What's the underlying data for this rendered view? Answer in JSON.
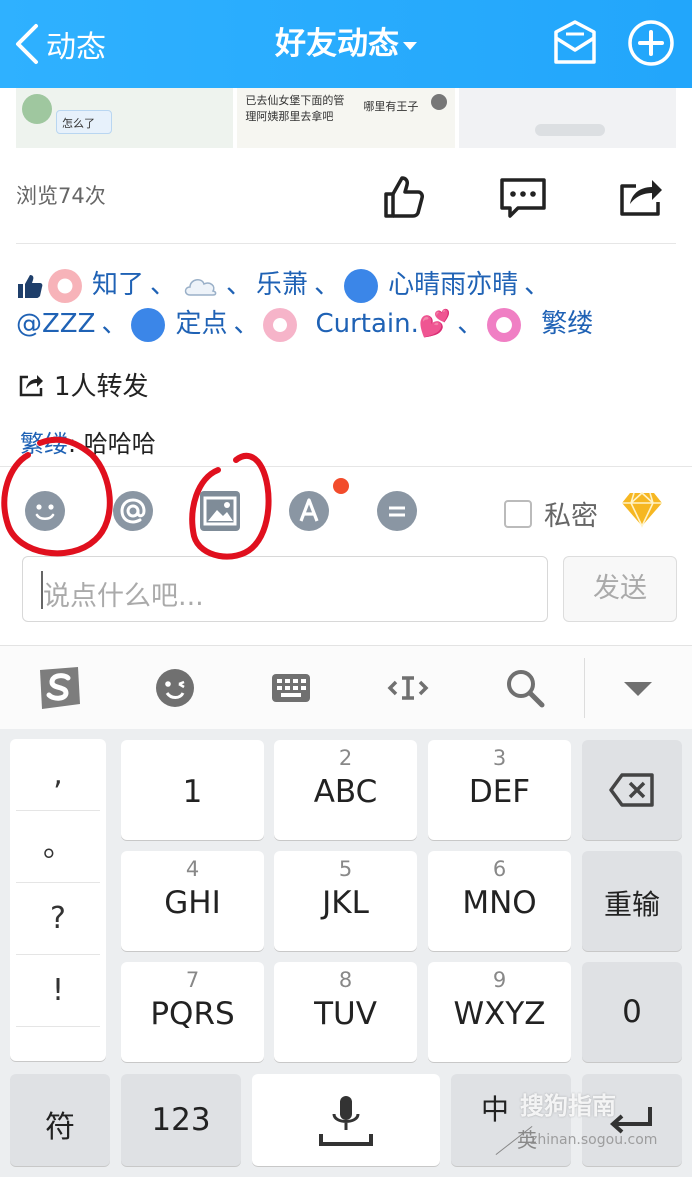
{
  "header": {
    "back_label": "动态",
    "title": "好友动态"
  },
  "thumbs": [
    {
      "texts": [
        "怎么了"
      ]
    },
    {
      "texts": [
        "已去仙女堡下面的管",
        "理阿姨那里去拿吧",
        "哪里有王子"
      ]
    },
    {
      "texts": []
    }
  ],
  "stats": {
    "views": "浏览74次"
  },
  "likes": {
    "row1": [
      "知了",
      "乐萧",
      "心晴雨亦晴"
    ],
    "row2": [
      "@ZZZ",
      "定点",
      "Curtain.💕",
      "繁缕"
    ],
    "separator": "、"
  },
  "repost": "1人转发",
  "comment": {
    "author": "繁缕",
    "text": "哈哈哈"
  },
  "toolbar": {
    "private_label": "私密"
  },
  "input": {
    "placeholder": "说点什么吧...",
    "send_label": "发送"
  },
  "keyboard": {
    "punct": [
      ",",
      "。",
      "?",
      "!"
    ],
    "keys": [
      {
        "num": "",
        "label": "1"
      },
      {
        "num": "2",
        "label": "ABC"
      },
      {
        "num": "3",
        "label": "DEF"
      },
      {
        "num": "4",
        "label": "GHI"
      },
      {
        "num": "5",
        "label": "JKL"
      },
      {
        "num": "6",
        "label": "MNO"
      },
      {
        "num": "7",
        "label": "PQRS"
      },
      {
        "num": "8",
        "label": "TUV"
      },
      {
        "num": "9",
        "label": "WXYZ"
      }
    ],
    "reinput": "重输",
    "zero": "0",
    "symbols": "符",
    "numbers": "123",
    "lang_main": "中",
    "lang_sub": "英"
  },
  "watermark": {
    "brand": "搜狗指南",
    "url": "zhinan.sogou.com"
  },
  "colors": {
    "header": "#22a6fb",
    "link": "#1f62b5",
    "annotation": "#e0101e"
  }
}
